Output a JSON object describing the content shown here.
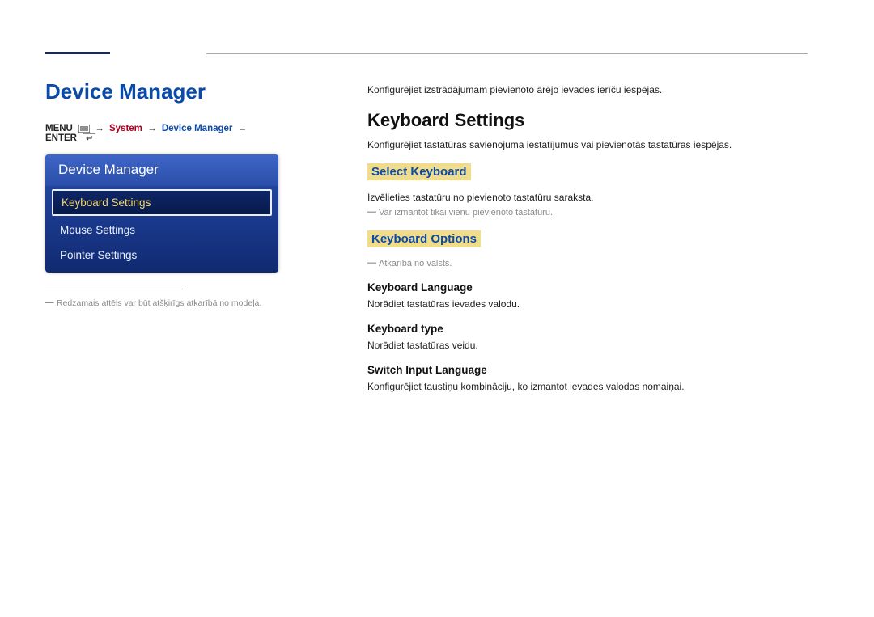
{
  "page": {
    "title": "Device Manager"
  },
  "breadcrumb": {
    "menu": "MENU",
    "system": "System",
    "deviceManager": "Device Manager",
    "enter": "ENTER"
  },
  "panel": {
    "header": "Device Manager",
    "items": [
      {
        "label": "Keyboard Settings",
        "selected": true
      },
      {
        "label": "Mouse Settings",
        "selected": false
      },
      {
        "label": "Pointer Settings",
        "selected": false
      }
    ]
  },
  "leftFootnote": "Redzamais attēls var būt atšķirīgs atkarībā no modeļa.",
  "content": {
    "intro": "Konfigurējiet izstrādājumam pievienoto ārējo ievades ierīču iespējas.",
    "h2": "Keyboard Settings",
    "h2desc": "Konfigurējiet tastatūras savienojuma iestatījumus vai pievienotās tastatūras iespējas.",
    "selectKeyboard": {
      "title": "Select Keyboard",
      "desc": "Izvēlieties tastatūru no pievienoto tastatūru saraksta.",
      "note": "Var izmantot tikai vienu pievienoto tastatūru."
    },
    "keyboardOptions": {
      "title": "Keyboard Options",
      "note": "Atkarībā no valsts.",
      "lang": {
        "title": "Keyboard Language",
        "desc": "Norādiet tastatūras ievades valodu."
      },
      "type": {
        "title": "Keyboard type",
        "desc": "Norādiet tastatūras veidu."
      },
      "switch": {
        "title": "Switch Input Language",
        "desc": "Konfigurējiet taustiņu kombināciju, ko izmantot ievades valodas nomaiņai."
      }
    }
  }
}
